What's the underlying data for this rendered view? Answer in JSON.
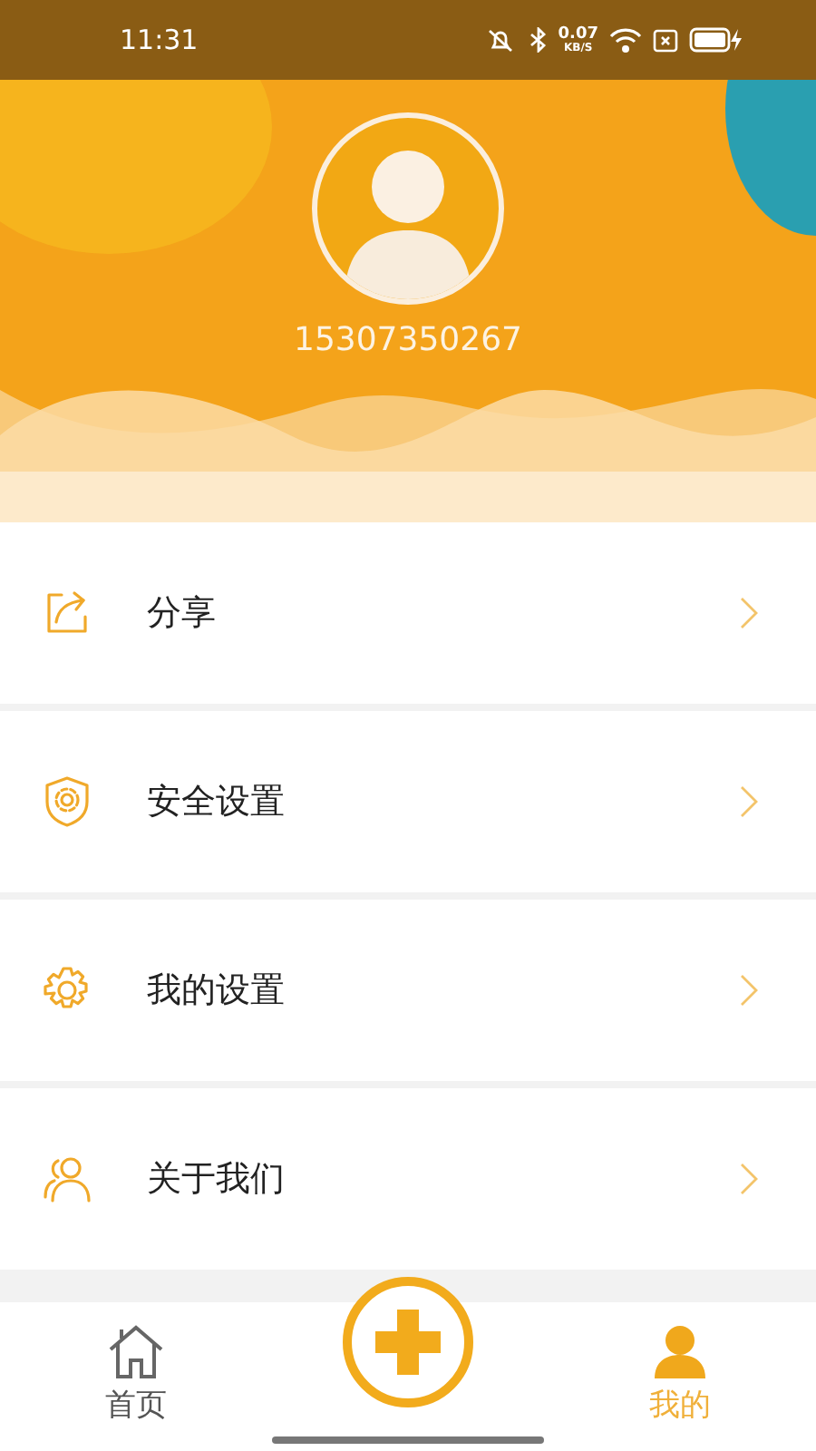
{
  "status_bar": {
    "time": "11:31",
    "speed": "0.07",
    "speed_unit": "KB/S"
  },
  "profile": {
    "phone": "15307350267"
  },
  "menu": [
    {
      "kind": "share",
      "label": "分享"
    },
    {
      "kind": "shield",
      "label": "安全设置"
    },
    {
      "kind": "gear",
      "label": "我的设置"
    },
    {
      "kind": "people",
      "label": "关于我们"
    }
  ],
  "tab_bar": [
    {
      "kind": "home",
      "label": "首页",
      "selected": false
    },
    {
      "kind": "add"
    },
    {
      "kind": "person",
      "label": "我的",
      "selected": true
    }
  ]
}
